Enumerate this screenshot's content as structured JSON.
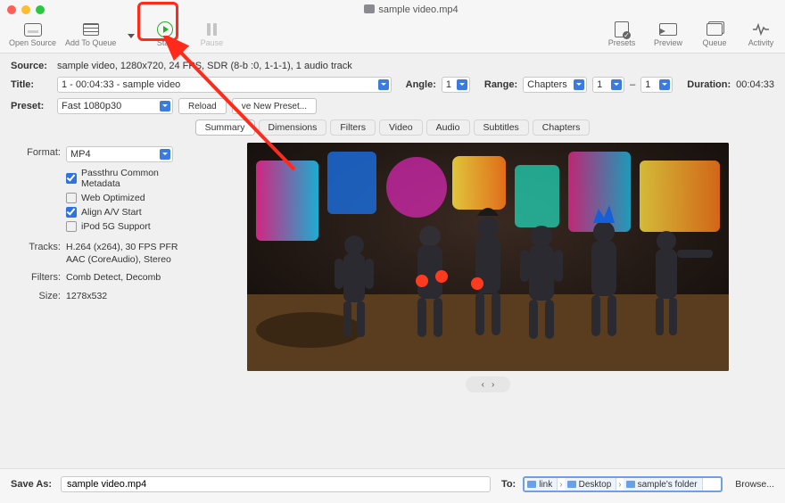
{
  "window": {
    "title": "sample video.mp4"
  },
  "toolbar": {
    "open_source": "Open Source",
    "add_to_queue": "Add To Queue",
    "start": "Start",
    "pause": "Pause",
    "presets": "Presets",
    "preview": "Preview",
    "queue": "Queue",
    "activity": "Activity"
  },
  "source": {
    "label": "Source:",
    "value": "sample video, 1280x720, 24 FPS, SDR (8-b     :0, 1-1-1), 1 audio track"
  },
  "title": {
    "label": "Title:",
    "value": "1 - 00:04:33 - sample video",
    "angle_label": "Angle:",
    "angle_value": "1",
    "range_label": "Range:",
    "range_mode": "Chapters",
    "range_from": "1",
    "range_sep": "–",
    "range_to": "1",
    "duration_label": "Duration:",
    "duration_value": "00:04:33"
  },
  "preset": {
    "label": "Preset:",
    "value": "Fast 1080p30",
    "reload": "Reload",
    "save_new": "ve New Preset..."
  },
  "tabs": [
    "Summary",
    "Dimensions",
    "Filters",
    "Video",
    "Audio",
    "Subtitles",
    "Chapters"
  ],
  "summary": {
    "format_label": "Format:",
    "format_value": "MP4",
    "opt_passthru": "Passthru Common Metadata",
    "opt_web": "Web Optimized",
    "opt_align": "Align A/V Start",
    "opt_ipod": "iPod 5G Support",
    "tracks_label": "Tracks:",
    "tracks_value": "H.264 (x264), 30 FPS PFR\nAAC (CoreAudio), Stereo",
    "filters_label": "Filters:",
    "filters_value": "Comb Detect, Decomb",
    "size_label": "Size:",
    "size_value": "1278x532"
  },
  "footer": {
    "save_as_label": "Save As:",
    "save_as_value": "sample video.mp4",
    "to_label": "To:",
    "path": [
      "link",
      "Desktop",
      "sample's folder"
    ],
    "browse": "Browse..."
  },
  "nav": {
    "prev": "‹",
    "next": "›"
  }
}
